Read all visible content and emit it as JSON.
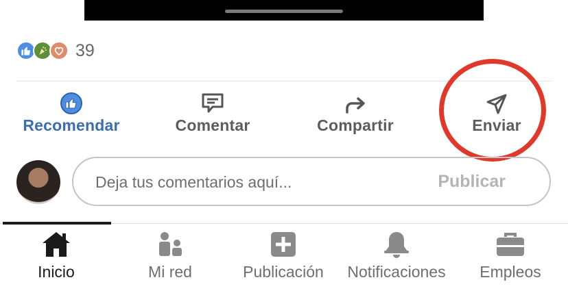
{
  "reactions": {
    "icons": [
      "like-reaction-icon",
      "celebrate-reaction-icon",
      "love-reaction-icon"
    ],
    "count": "39"
  },
  "actions": {
    "like": {
      "label": "Recomendar",
      "icon": "thumbs-up-icon",
      "color": "#3b6eb0"
    },
    "comment": {
      "label": "Comentar",
      "icon": "speech-bubble-icon"
    },
    "share": {
      "label": "Compartir",
      "icon": "share-arrow-icon"
    },
    "send": {
      "label": "Enviar",
      "icon": "paper-plane-icon"
    }
  },
  "annotation": {
    "color": "#e0392b"
  },
  "comment": {
    "placeholder": "Deja tus comentarios aquí...",
    "value": "",
    "publish_label": "Publicar"
  },
  "nav": {
    "active": "Inicio",
    "items": [
      {
        "label": "Inicio",
        "icon": "home-icon"
      },
      {
        "label": "Mi red",
        "icon": "my-network-icon"
      },
      {
        "label": "Publicación",
        "icon": "add-post-icon"
      },
      {
        "label": "Notificaciones",
        "icon": "bell-icon"
      },
      {
        "label": "Empleos",
        "icon": "briefcase-icon"
      }
    ]
  }
}
